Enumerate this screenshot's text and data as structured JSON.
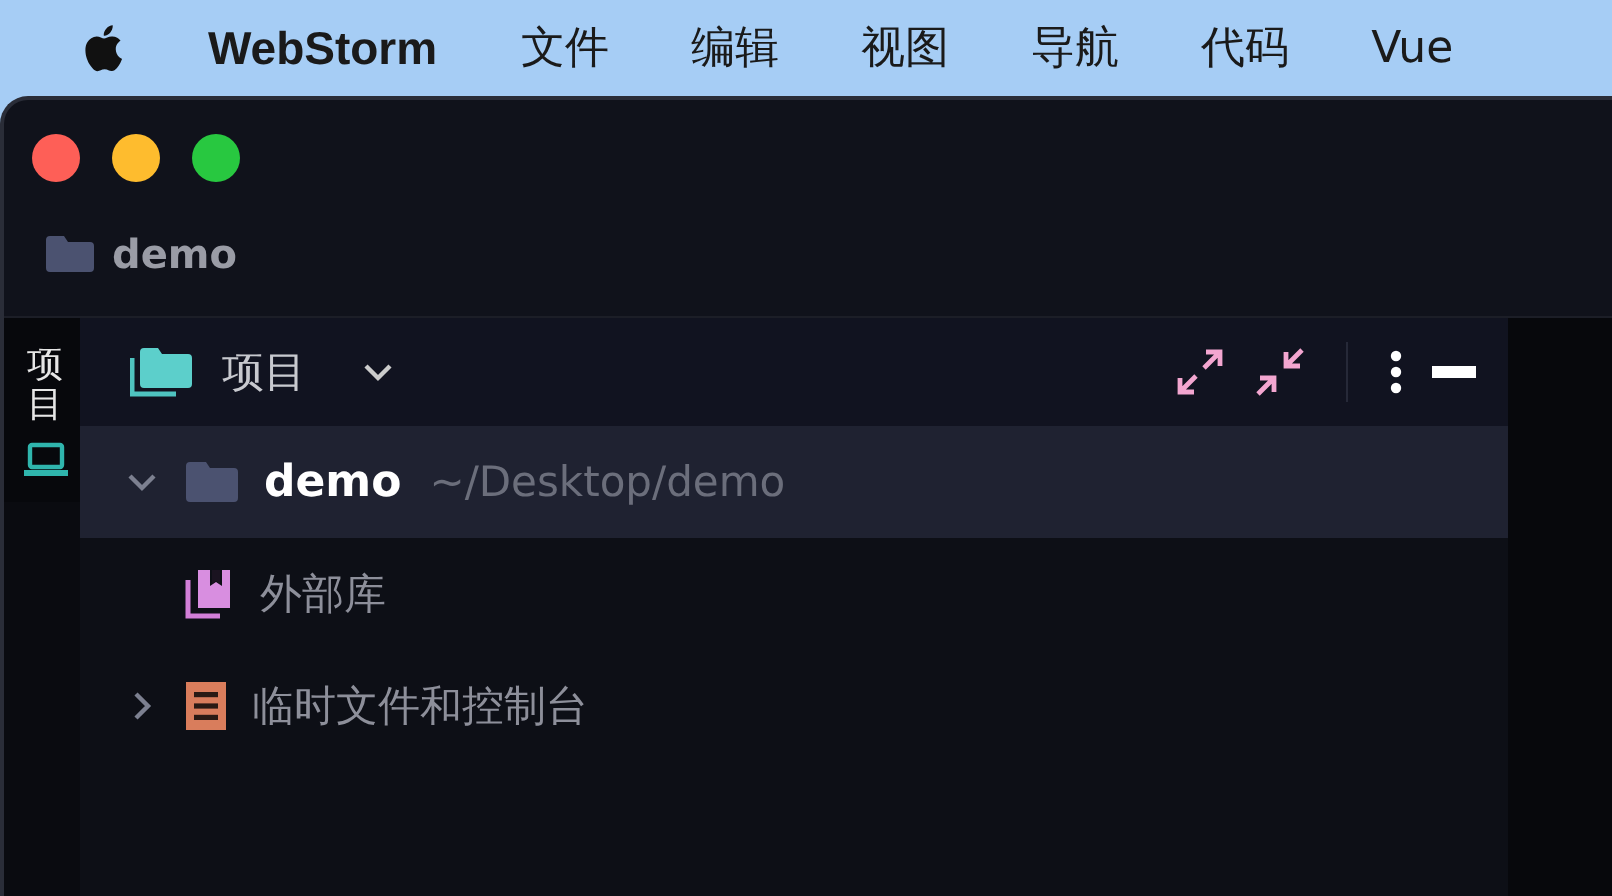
{
  "menu_bar": {
    "app_name": "WebStorm",
    "items": [
      "文件",
      "编辑",
      "视图",
      "导航",
      "代码",
      "Vue"
    ]
  },
  "window": {
    "breadcrumb": "demo"
  },
  "tool_strip": {
    "tabs": [
      {
        "label": "项目",
        "selected": true
      }
    ]
  },
  "project_panel": {
    "title": "项目",
    "tree": [
      {
        "kind": "folder",
        "name": "demo",
        "path": "~/Desktop/demo",
        "expanded": true,
        "selected": true
      },
      {
        "kind": "library",
        "name": "外部库",
        "selected": false
      },
      {
        "kind": "scratch",
        "name": "临时文件和控制台",
        "expanded": false,
        "selected": false
      }
    ]
  }
}
